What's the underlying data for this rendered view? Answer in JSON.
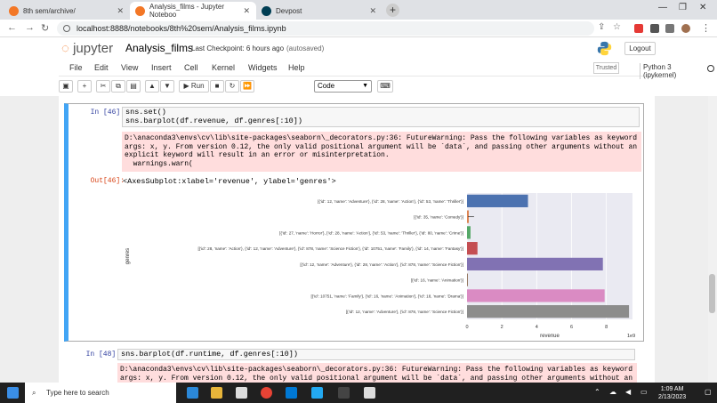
{
  "browser": {
    "tabs": [
      {
        "label": "8th sem/archive/"
      },
      {
        "label": "Analysis_films - Jupyter Noteboo"
      },
      {
        "label": "Devpost"
      }
    ],
    "url": "localhost:8888/notebooks/8th%20sem/Analysis_films.ipynb",
    "accent": "#1a73e8"
  },
  "jupyter": {
    "logo": "jupyter",
    "notebook_title": "Analysis_films",
    "checkpoint": "Last Checkpoint: 6 hours ago",
    "autosave": "(autosaved)",
    "logout": "Logout",
    "trusted": "Trusted",
    "kernel": "Python 3 (ipykernel)",
    "menu": [
      "File",
      "Edit",
      "View",
      "Insert",
      "Cell",
      "Kernel",
      "Widgets",
      "Help"
    ],
    "run_label": "Run",
    "cell_type": "Code"
  },
  "cells": {
    "c46": {
      "prompt_in": "In [46]:",
      "line1": "sns.set()",
      "line2": "sns.barplot(df.revenue, df.genres[:10])",
      "warning": "D:\\anaconda3\\envs\\cv\\lib\\site-packages\\seaborn\\_decorators.py:36: FutureWarning: Pass the following variables as keyword args: x, y. From version 0.12, the only valid positional argument will be `data`, and passing other arguments without an explicit keyword will result in an error or misinterpretation.\n  warnings.warn(",
      "prompt_out": "Out[46]:",
      "out_text": "<AxesSubplot:xlabel='revenue', ylabel='genres'>"
    },
    "c48": {
      "prompt_in": "In [48]:",
      "line1": "sns.barplot(df.runtime, df.genres[:10])",
      "warning": "D:\\anaconda3\\envs\\cv\\lib\\site-packages\\seaborn\\_decorators.py:36: FutureWarning: Pass the following variables as keyword args: x, y. From version 0.12, the only valid positional argument will be `data`, and passing other arguments without an explicit keyword"
    }
  },
  "chart_data": {
    "type": "bar",
    "orientation": "horizontal",
    "xlabel": "revenue",
    "ylabel": "genres",
    "x_offset_label": "1e9",
    "xlim": [
      0,
      9.5
    ],
    "xticks": [
      0,
      2,
      4,
      6,
      8
    ],
    "grid": true,
    "categories": [
      "[{'id': 12, 'name': 'Adventure'}, {'id': 28, 'name': 'Action'}, {'id': 53, 'name': 'Thriller'}]",
      "[{'id': 35, 'name': 'Comedy'}]",
      "[{'id': 27, 'name': 'Horror'}, {'id': 28, 'name': 'Action'}, {'id': 53, 'name': 'Thriller'}, {'id': 80, 'name': 'Crime'}]",
      "[{'id': 28, 'name': 'Action'}, {'id': 12, 'name': 'Adventure'}, {'id': 878, 'name': 'Science Fiction'}, {'id': 10751, 'name': 'Family'}, {'id': 14, 'name': 'Fantasy'}]",
      "[{'id': 12, 'name': 'Adventure'}, {'id': 28, 'name': 'Action'}, {'id': 878, 'name': 'Science Fiction'}]",
      "[{'id': 16, 'name': 'Animation'}]",
      "[{'id': 10751, 'name': 'Family'}, {'id': 16, 'name': 'Animation'}, {'id': 18, 'name': 'Drama'}]",
      "[{'id': 12, 'name': 'Adventure'}, {'id': 878, 'name': 'Science Fiction'}]"
    ],
    "values": [
      3.5,
      0.1,
      0.2,
      0.6,
      7.8,
      0.05,
      7.9,
      9.3
    ],
    "errors": [
      0,
      0.15,
      0,
      0,
      0,
      0,
      0,
      0
    ],
    "colors": [
      "#4c72b0",
      "#dd8452",
      "#55a868",
      "#c44e52",
      "#8172b3",
      "#937860",
      "#da8bc3",
      "#8c8c8c"
    ]
  },
  "taskbar": {
    "search_placeholder": "Type here to search",
    "time": "1:09 AM",
    "date": "2/13/2023"
  }
}
